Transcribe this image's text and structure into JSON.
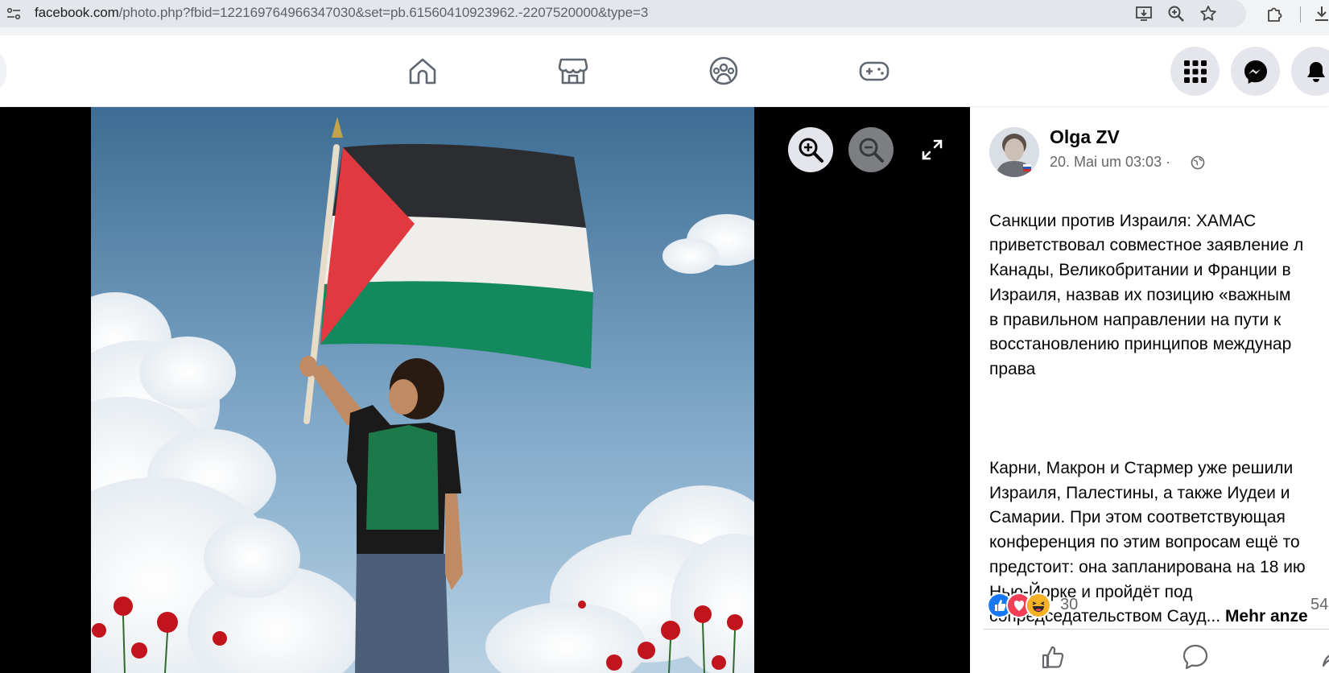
{
  "browser": {
    "url_host": "facebook.com",
    "url_path": "/photo.php?fbid=122169764966347030&set=pb.61560410923962.-2207520000&type=3",
    "icons": [
      "site-info-icon",
      "install-app-icon",
      "zoom-icon",
      "bookmark-star-icon",
      "extensions-icon",
      "download-icon"
    ]
  },
  "nav": {
    "icons": [
      "home-icon",
      "marketplace-icon",
      "groups-icon",
      "gaming-icon"
    ],
    "right_buttons": [
      "menu-grid-icon",
      "messenger-icon",
      "notifications-bell-icon"
    ]
  },
  "viewer": {
    "controls": [
      "zoom-in-icon",
      "zoom-out-icon",
      "fullscreen-icon"
    ]
  },
  "post": {
    "author": "Olga ZV",
    "time": "20. Mai um 03:03 ·",
    "paragraph1": "Санкции против Израиля: ХАМАС\nприветствовал совместное заявление л\nКанады, Великобритании и Франции в\nИзраиля, назвав их позицию «важным\nв правильном направлении на пути к\nвосстановлению принципов междунар\nправа",
    "paragraph2": "Карни, Макрон и Стармер уже решили\nИзраиля, Палестины, а также Иудеи и\nСамарии. При этом соответствующая\nконференция по этим вопросам ещё то\nпредстоит: она запланирована на 18 ию\nНью-Йорке и пройдёт под\nсопредседательством Сауд...",
    "see_more": "Mehr anze",
    "reaction_count": "30",
    "right_count": "54",
    "reaction_icons": [
      "like-reaction-icon",
      "love-reaction-icon",
      "haha-reaction-icon"
    ],
    "actions": [
      "like-action-icon",
      "comment-action-icon",
      "share-action-icon"
    ]
  }
}
